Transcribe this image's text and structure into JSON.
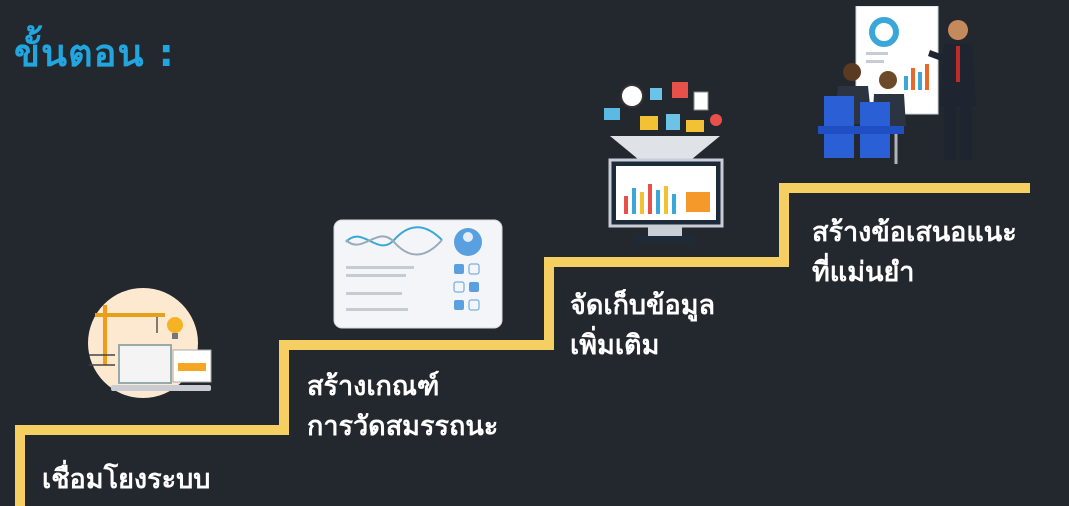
{
  "title": "ขั้นตอน :",
  "steps": [
    {
      "lines": [
        "เชื่อมโยงระบบ"
      ],
      "illustration": "construction-laptop-illustration"
    },
    {
      "lines": [
        "สร้างเกณฑ์",
        "การวัดสมรรถนะ"
      ],
      "illustration": "profile-dashboard-illustration"
    },
    {
      "lines": [
        "จัดเก็บข้อมูล",
        "เพิ่มเติม"
      ],
      "illustration": "data-funnel-monitor-illustration"
    },
    {
      "lines": [
        "สร้างข้อเสนอแนะ",
        "ที่แม่นยำ"
      ],
      "illustration": "presentation-meeting-illustration"
    }
  ],
  "colors": {
    "title": "#21a6e0",
    "stairs": "#f6cf62",
    "background": "#23272e",
    "text": "#ffffff"
  }
}
